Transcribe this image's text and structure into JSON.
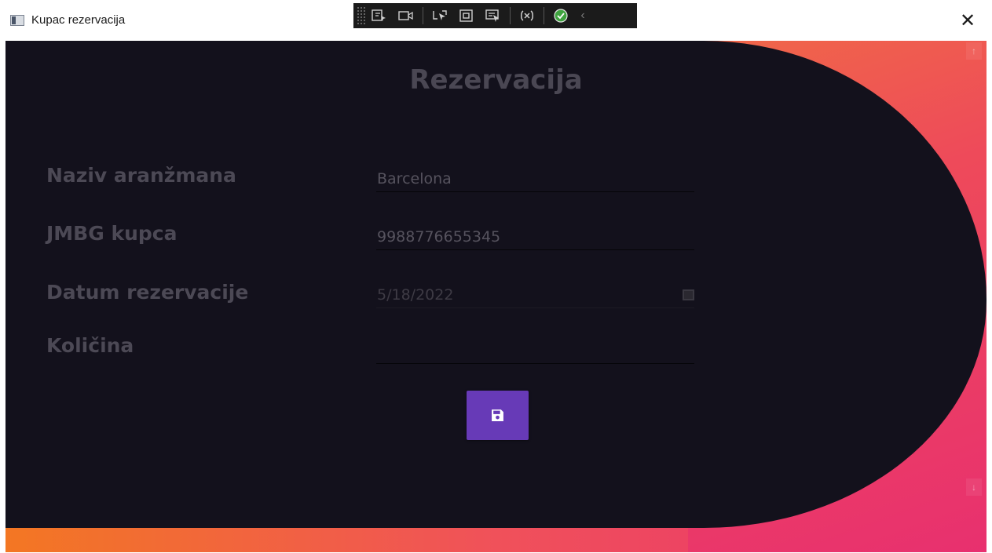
{
  "window": {
    "title": "Kupac rezervacija",
    "close_glyph": "✕"
  },
  "debug_toolbar": {
    "tools": [
      {
        "name": "live-visual-tree-icon"
      },
      {
        "name": "video-record-icon"
      },
      {
        "name": "select-element-icon"
      },
      {
        "name": "layout-adorners-icon"
      },
      {
        "name": "track-focus-icon"
      },
      {
        "name": "binding-failures-icon"
      },
      {
        "name": "checkmark-icon"
      }
    ],
    "collapse_glyph": "‹"
  },
  "form": {
    "title": "Rezervacija",
    "fields": [
      {
        "label": "Naziv aranžmana",
        "value": ""
      },
      {
        "label": "JMBG kupca",
        "value": "9988776655345"
      },
      {
        "label": "Datum rezervacije",
        "value": "5/18/2022"
      },
      {
        "label": "Količina",
        "value": ""
      }
    ],
    "arrangement_value": "Barcelona"
  },
  "scroll": {
    "up_glyph": "↑",
    "down_glyph": "↓"
  },
  "colors": {
    "panel_bg": "#13111c",
    "accent": "#673ab7",
    "gradient_start": "#f37723",
    "gradient_end": "#e8306f"
  }
}
